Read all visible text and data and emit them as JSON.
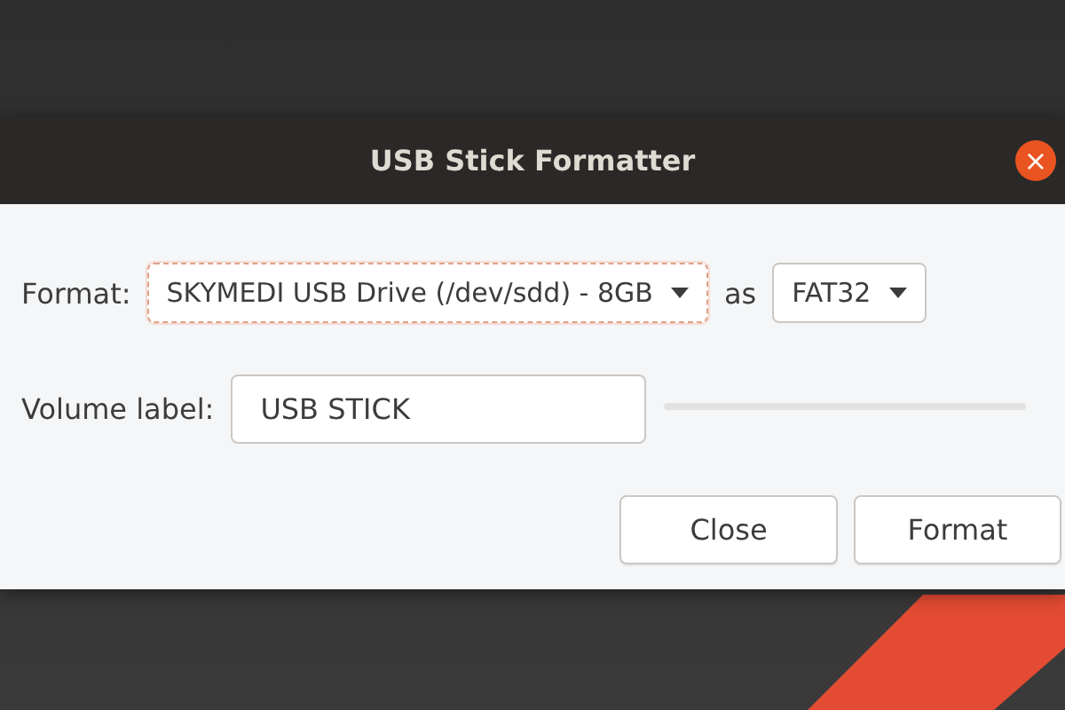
{
  "window": {
    "title": "USB Stick Formatter",
    "close_icon": "×"
  },
  "format_row": {
    "label": "Format:",
    "device": {
      "value": "SKYMEDI USB Drive (/dev/sdd) - 8GB",
      "focused": true
    },
    "connector": "as",
    "filesystem": {
      "value": "FAT32",
      "focused": false
    }
  },
  "volume_row": {
    "label": "Volume label:",
    "value": "USB STICK",
    "progress": {
      "level": 0
    }
  },
  "buttons": [
    "Close",
    "Format"
  ]
}
